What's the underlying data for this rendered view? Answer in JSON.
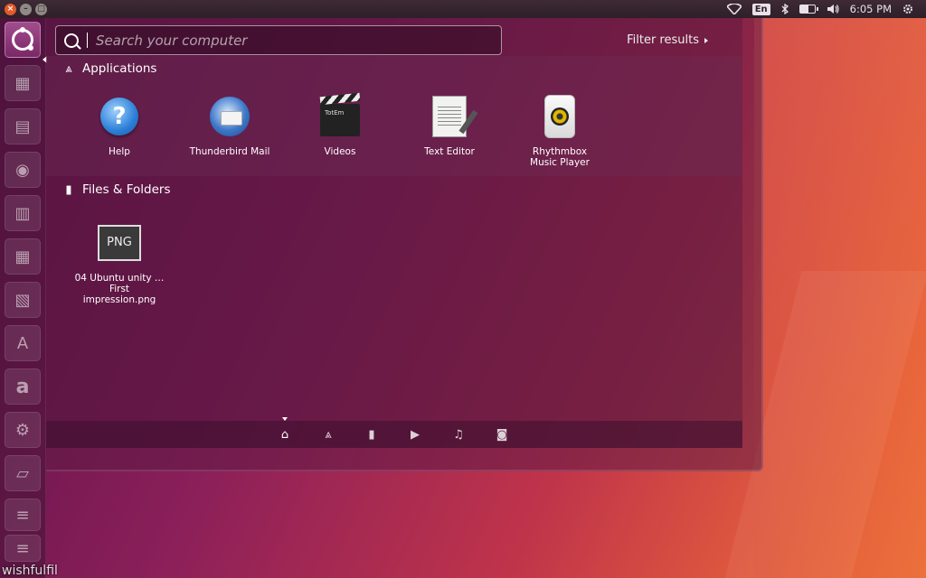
{
  "top_panel": {
    "language": "En",
    "clock": "6:05 PM",
    "battery_level_percent": 60
  },
  "launcher": {
    "items": [
      {
        "name": "dash-home",
        "icon": "ubuntu-logo-icon"
      },
      {
        "name": "files",
        "icon": "folder-icon"
      },
      {
        "name": "file-manager",
        "icon": "archive-icon"
      },
      {
        "name": "firefox",
        "icon": "firefox-icon"
      },
      {
        "name": "writer",
        "icon": "document-icon"
      },
      {
        "name": "calc",
        "icon": "spreadsheet-icon"
      },
      {
        "name": "impress",
        "icon": "presentation-icon"
      },
      {
        "name": "software-center",
        "icon": "software-center-icon"
      },
      {
        "name": "amazon",
        "icon": "amazon-icon"
      },
      {
        "name": "settings",
        "icon": "gear-icon"
      },
      {
        "name": "workspaces",
        "icon": "workspace-icon"
      },
      {
        "name": "trash",
        "icon": "trash-icon"
      }
    ],
    "amazon_glyph": "a",
    "software_glyph": "A"
  },
  "dash": {
    "search": {
      "placeholder": "Search your computer",
      "value": ""
    },
    "filter_label": "Filter results",
    "applications_header": "Applications",
    "files_header": "Files & Folders",
    "apps": [
      {
        "label": "Help",
        "icon": "help-icon",
        "glyph": "?"
      },
      {
        "label": "Thunderbird Mail",
        "icon": "thunderbird-icon"
      },
      {
        "label": "Videos",
        "icon": "clapperboard-icon",
        "glyph": "TotEm"
      },
      {
        "label": "Text Editor",
        "icon": "text-editor-icon"
      },
      {
        "label": "Rhythmbox Music Player",
        "icon": "speaker-icon"
      }
    ],
    "files": [
      {
        "label": "04 Ubuntu unity … First impression.png",
        "icon": "png-file-icon",
        "thumb_text": "PNG"
      }
    ],
    "lenses": [
      {
        "name": "home",
        "icon": "home-icon",
        "active": true
      },
      {
        "name": "applications",
        "icon": "applications-icon",
        "active": false
      },
      {
        "name": "files",
        "icon": "file-icon",
        "active": false
      },
      {
        "name": "videos",
        "icon": "video-icon",
        "active": false
      },
      {
        "name": "music",
        "icon": "music-icon",
        "active": false
      },
      {
        "name": "photos",
        "icon": "camera-icon",
        "active": false
      }
    ]
  },
  "watermark": "wishfulfil"
}
